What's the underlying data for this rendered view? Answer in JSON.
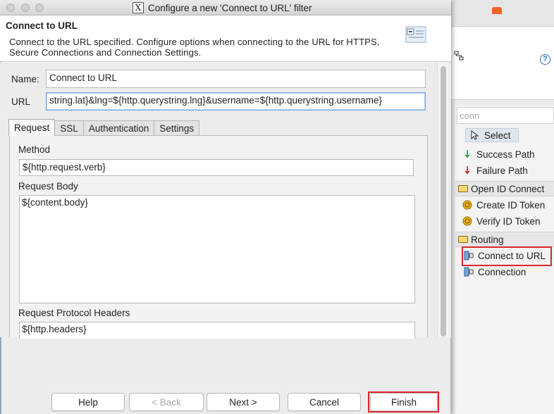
{
  "window": {
    "title": "Configure a new 'Connect to URL' filter"
  },
  "header": {
    "title": "Connect to URL",
    "description": "Connect to the URL specified.  Configure options when connecting to the URL for HTTPS, Secure Connections and Connection Settings."
  },
  "form": {
    "name_label": "Name:",
    "name_value": "Connect to URL",
    "url_label": "URL",
    "url_value": "string.lat}&lng=${http.querystring.lng}&username=${http.querystring.username}"
  },
  "tabs": [
    {
      "label": "Request",
      "active": true
    },
    {
      "label": "SSL",
      "active": false
    },
    {
      "label": "Authentication",
      "active": false
    },
    {
      "label": "Settings",
      "active": false
    }
  ],
  "request": {
    "method_label": "Method",
    "method_value": "${http.request.verb}",
    "body_label": "Request Body",
    "body_value": "${content.body}",
    "headers_label": "Request Protocol Headers",
    "headers_value": "${http.headers}"
  },
  "buttons": {
    "help": "Help",
    "back": "< Back",
    "next": "Next >",
    "cancel": "Cancel",
    "finish": "Finish"
  },
  "palette": {
    "search_placeholder": "conn",
    "select": "Select",
    "success_path": "Success Path",
    "failure_path": "Failure Path",
    "category_openid": "Open ID Connect",
    "create_id_token": "Create ID Token",
    "verify_id_token": "Verify ID Token",
    "category_routing": "Routing",
    "connect_to_url": "Connect to URL",
    "connection": "Connection"
  },
  "colors": {
    "highlight": "#d9262c",
    "success_arrow": "#2e9e3a",
    "failure_arrow": "#c62828",
    "help_icon": "#2a6fc9"
  },
  "icons": {
    "help": "help-icon",
    "select": "pointer-icon",
    "success": "down-arrow-green-icon",
    "failure": "down-arrow-red-icon",
    "folder": "folder-icon",
    "token": "token-coin-icon",
    "connect": "connect-url-icon"
  }
}
